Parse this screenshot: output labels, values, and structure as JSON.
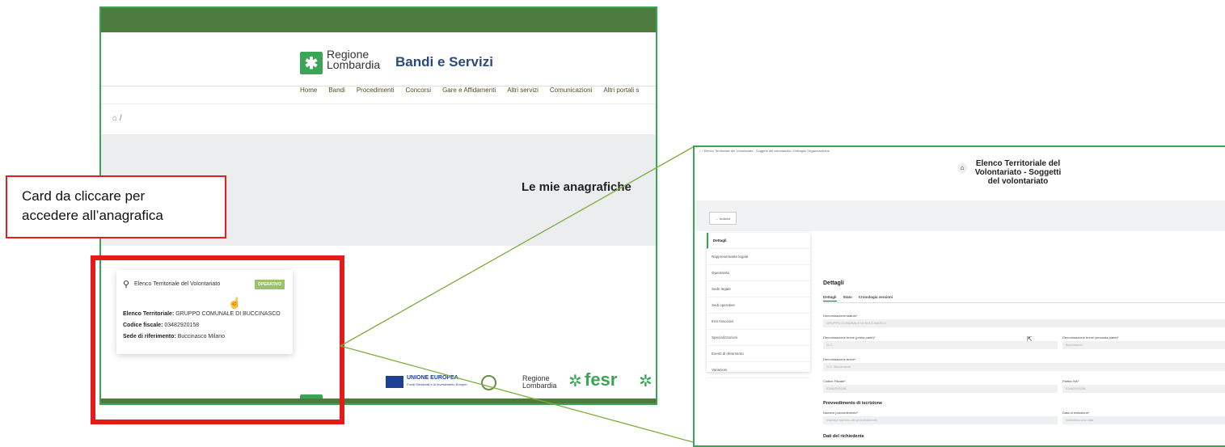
{
  "annotation": {
    "callout_line1": "Card da cliccare per",
    "callout_line2": "accedere all’anagrafica"
  },
  "left": {
    "logo_line1": "Regione",
    "logo_line2": "Lombardia",
    "site_title": "Bandi e Servizi",
    "nav": [
      "Home",
      "Bandi",
      "Procedimenti",
      "Concorsi",
      "Gare e Affidamenti",
      "Altri servizi",
      "Comunicazioni",
      "Altri portali s"
    ],
    "breadcrumb_sep": "/",
    "hero_title": "Le mie anagrafiche",
    "card": {
      "title": "Elenco Territoriale del Volontariato",
      "badge": "OPERATIVO",
      "elenco_label": "Elenco Territoriale:",
      "elenco_value": "GRUPPO COMUNALE DI BUCCINASCO",
      "cf_label": "Codice fiscale:",
      "cf_value": "03482920158",
      "sede_label": "Sede di riferimento:",
      "sede_value": "Buccinasco Milano"
    },
    "footer": {
      "eu_title": "UNIONE EUROPEA",
      "eu_sub": "Fondi Strutturali e di Investimento Europei",
      "rl_line1": "Regione",
      "rl_line2": "Lombardia",
      "fesr": "fesr"
    }
  },
  "right": {
    "breadcrumb": "Elenco Territoriale del Volontariato - Soggetti del volontariato  /  Dettaglio Organizzazione",
    "title": "Elenco Territoriale del Volontariato - Soggetti del volontariato",
    "back_label": "← Indietro",
    "sidebar": [
      "Dettagli",
      "Rappresentante legale",
      "Operatività",
      "Sede legale",
      "Sedi operative",
      "Enti Associati",
      "Specializzazioni",
      "Eventi di riferimento",
      "Variazioni"
    ],
    "section_title": "Dettagli",
    "tabs": [
      "Dettagli",
      "Stato",
      "Cronologia versioni"
    ],
    "fields": {
      "denominazione_statuto_label": "Denominazione statuto*",
      "denominazione_statuto_value": "GRUPPO COMUNALE DI BUCCINASCO",
      "den_breve_prima_label": "Denominazione breve (prima parte)*",
      "den_breve_prima_value": "G.C.",
      "den_breve_seconda_label": "Denominazione breve (seconda parte)*",
      "den_breve_seconda_value": "Buccinasco",
      "den_breve_label": "Denominazione breve*",
      "den_breve_value": "G.C. Buccinasco",
      "cf_label": "Codice Fiscale*",
      "cf_value": "03482920158",
      "piva_label": "Partita IVA*",
      "piva_value": "03482920158"
    },
    "provvedimento_title": "Provvedimento di iscrizione",
    "numero_label": "Numero provvedimento*",
    "numero_placeholder": "Inserisci numero del provvedimento",
    "data_label": "Data di emissione*",
    "data_placeholder": "Seleziona una data",
    "richiedente_title": "Dati del richiedente"
  },
  "colors": {
    "brand_green": "#3aa655",
    "dark_green": "#4d7b3d",
    "callout_red": "#e31b1b"
  }
}
